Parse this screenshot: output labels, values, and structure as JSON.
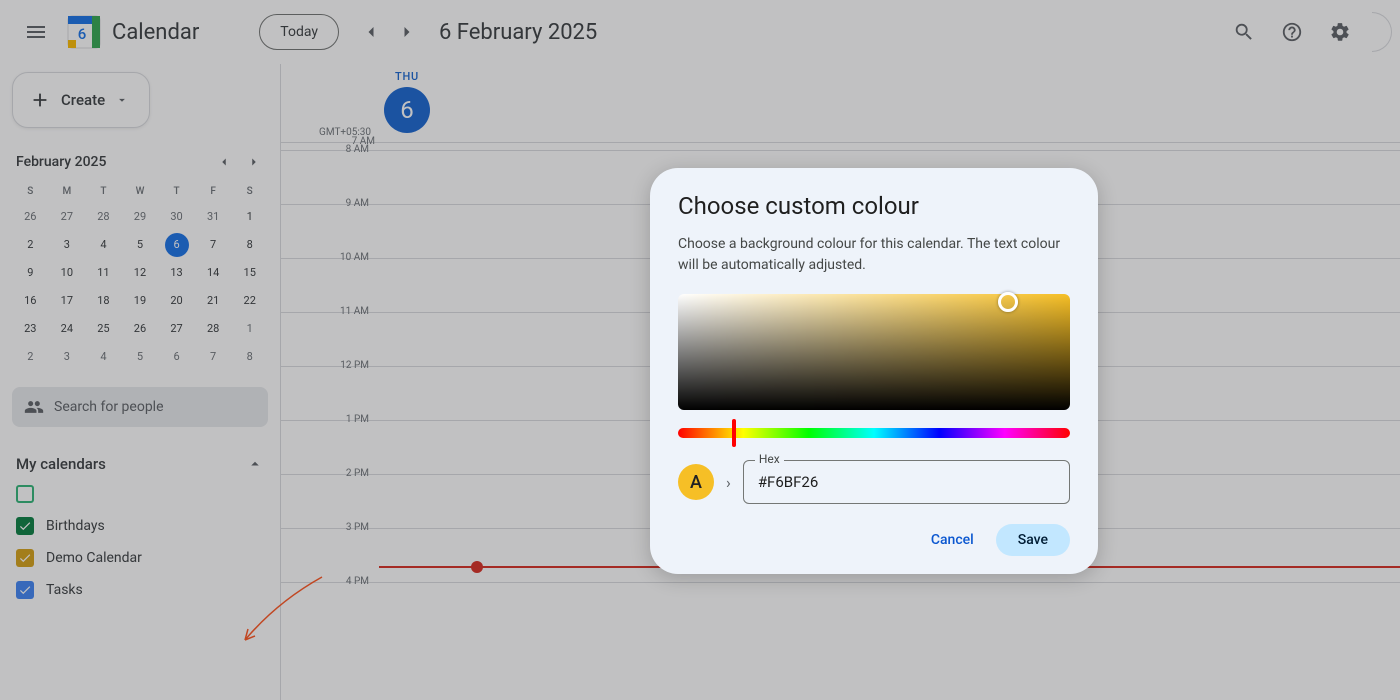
{
  "header": {
    "app_title": "Calendar",
    "logo_day": "6",
    "today_label": "Today",
    "date_title": "6 February 2025"
  },
  "sidebar": {
    "create_label": "Create",
    "mini_month": "February 2025",
    "dow": [
      "S",
      "M",
      "T",
      "W",
      "T",
      "F",
      "S"
    ],
    "prev_days": [
      "26",
      "27",
      "28",
      "29",
      "30",
      "31"
    ],
    "days": [
      "1",
      "2",
      "3",
      "4",
      "5",
      "6",
      "7",
      "8",
      "9",
      "10",
      "11",
      "12",
      "13",
      "14",
      "15",
      "16",
      "17",
      "18",
      "19",
      "20",
      "21",
      "22",
      "23",
      "24",
      "25",
      "26",
      "27",
      "28"
    ],
    "next_days": [
      "1",
      "2",
      "3",
      "4",
      "5",
      "6",
      "7",
      "8"
    ],
    "today_index": 5,
    "search_placeholder": "Search for people",
    "section_label": "My calendars",
    "calendars": [
      {
        "name": "",
        "color": "#33b679",
        "checked": false,
        "redacted": true
      },
      {
        "name": "Birthdays",
        "color": "#0b8043",
        "checked": true
      },
      {
        "name": "Demo Calendar",
        "color": "#d6a21a",
        "checked": true
      },
      {
        "name": "Tasks",
        "color": "#4285f4",
        "checked": true
      }
    ]
  },
  "dayview": {
    "tz": "GMT+05:30",
    "weekday": "THU",
    "daynum": "6",
    "first_hour_label": "7 AM",
    "hours": [
      "8 AM",
      "9 AM",
      "10 AM",
      "11 AM",
      "12 PM",
      "1 PM",
      "2 PM",
      "3 PM",
      "4 PM"
    ]
  },
  "modal": {
    "title": "Choose custom colour",
    "desc": "Choose a background colour for this calendar. The text colour will be automatically adjusted.",
    "hex_label": "Hex",
    "hex_value": "#F6BF26",
    "preview_letter": "A",
    "preview_bg": "#f6bf26",
    "preview_fg": "#202124",
    "cancel": "Cancel",
    "save": "Save"
  }
}
